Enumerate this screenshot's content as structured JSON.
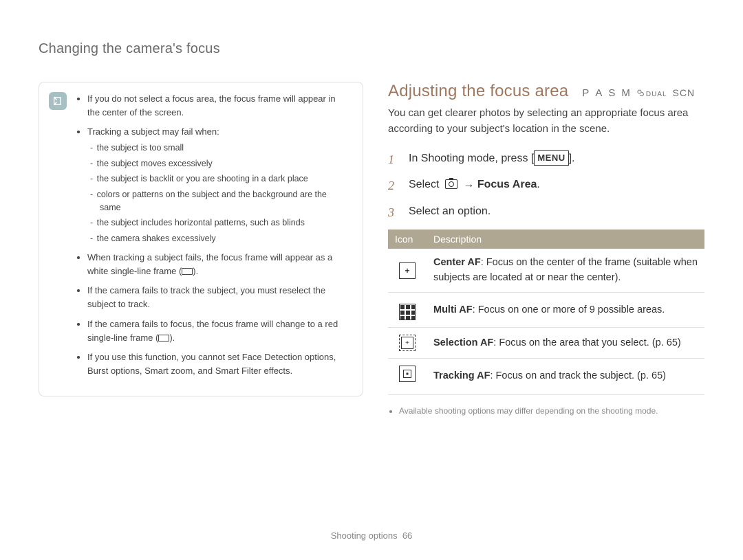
{
  "running_head": "Changing the camera's focus",
  "note": {
    "bullets": [
      {
        "text_parts": [
          "If you do not select a focus area, the focus frame will appear in the center of the screen."
        ]
      },
      {
        "text_parts": [
          "Tracking a subject may fail when:"
        ],
        "sublist_kind": "dash",
        "sublist": [
          "the subject is too small",
          "the subject moves excessively",
          "the subject is backlit or you are shooting in a dark place",
          "colors or patterns on the subject and the background are the same",
          "the subject includes horizontal patterns, such as blinds",
          "the camera shakes excessively"
        ]
      },
      {
        "text_parts": [
          "When tracking a subject fails, the focus frame will appear as a white single-line frame (",
          "FRAME",
          ")."
        ]
      },
      {
        "text_parts": [
          "If the camera fails to track the subject, you must reselect the subject to track."
        ]
      },
      {
        "text_parts": [
          "If the camera fails to focus, the focus frame will change to a red single-line frame (",
          "FRAME",
          ")."
        ]
      },
      {
        "text_parts": [
          "If you use this function, you cannot set Face Detection options, Burst options, Smart zoom, and Smart Filter effects."
        ]
      }
    ]
  },
  "section": {
    "title": "Adjusting the focus area",
    "modes": {
      "p": "P",
      "a": "A",
      "s": "S",
      "m": "M",
      "dual": "DUAL",
      "scn": "SCN"
    },
    "intro": "You can get clearer photos by selecting an appropriate focus area according to your subject's location in the scene.",
    "steps": {
      "s1_pre": "In Shooting mode, press [",
      "s1_menu": "MENU",
      "s1_post": "].",
      "s2_pre": "Select ",
      "s2_arrow": " → ",
      "s2_bold": "Focus Area",
      "s2_post": ".",
      "s3": "Select an option."
    },
    "table": {
      "head_icon": "Icon",
      "head_desc": "Description",
      "rows": [
        {
          "icon": "center",
          "name": "Center AF",
          "desc": ": Focus on the center of the frame (suitable when subjects are located at or near the center)."
        },
        {
          "icon": "multi",
          "name": "Multi AF",
          "desc": ": Focus on one or more of 9 possible areas."
        },
        {
          "icon": "selection",
          "name": "Selection AF",
          "desc": ": Focus on the area that you select. (p. 65)"
        },
        {
          "icon": "tracking",
          "name": "Tracking AF",
          "desc": ": Focus on and track the subject. (p. 65)"
        }
      ]
    },
    "footnote": "Available shooting options may differ depending on the shooting mode."
  },
  "footer": {
    "section": "Shooting options",
    "page": "66"
  }
}
